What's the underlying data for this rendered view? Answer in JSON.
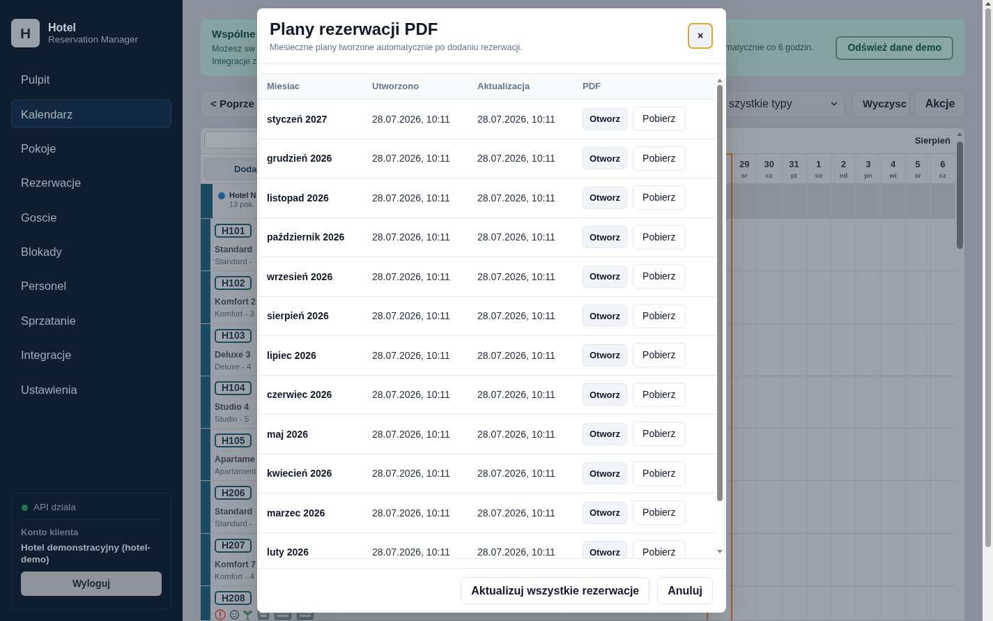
{
  "sidebar": {
    "logo": "H",
    "title": "Hotel",
    "subtitle": "Reservation Manager",
    "items": [
      {
        "label": "Pulpit",
        "selected": false
      },
      {
        "label": "Kalendarz",
        "selected": true
      },
      {
        "label": "Pokoje",
        "selected": false
      },
      {
        "label": "Rezerwacje",
        "selected": false
      },
      {
        "label": "Goscie",
        "selected": false
      },
      {
        "label": "Blokady",
        "selected": false
      },
      {
        "label": "Personel",
        "selected": false
      },
      {
        "label": "Sprzatanie",
        "selected": false
      },
      {
        "label": "Integracje",
        "selected": false
      },
      {
        "label": "Ustawienia",
        "selected": false
      }
    ],
    "status": {
      "label": "API dziala",
      "ok": true
    },
    "account": {
      "heading": "Konto klienta",
      "name": "Hotel demonstracyjny (hotel-demo)",
      "button": "Wyloguj"
    }
  },
  "banner": {
    "title": "Wspólne",
    "lines": [
      "Możesz sw",
      "Integracje z"
    ],
    "note": "matycznie co 6 godzin.",
    "button": "Odśwież dane demo"
  },
  "toolbar": {
    "prev_button": "< Poprze",
    "type_select": "szystkie typy",
    "clear_button": "Wyczysc",
    "actions_button": "Akcje"
  },
  "calendar": {
    "add_button": "Doda",
    "month": "Sierpień",
    "today_marker": true,
    "group": {
      "name": "Hotel N",
      "count": "13 pok."
    },
    "days": [
      {
        "day": "29",
        "weekday": "sr"
      },
      {
        "day": "30",
        "weekday": "cz"
      },
      {
        "day": "31",
        "weekday": "pt"
      },
      {
        "day": "1",
        "weekday": "so"
      },
      {
        "day": "2",
        "weekday": "nd"
      },
      {
        "day": "3",
        "weekday": "pn"
      },
      {
        "day": "4",
        "weekday": "wt"
      },
      {
        "day": "5",
        "weekday": "sr"
      },
      {
        "day": "6",
        "weekday": "cz"
      }
    ],
    "rooms": [
      {
        "kind": "text",
        "code": "H101",
        "name": "Standard",
        "detail": "Standard -"
      },
      {
        "kind": "text",
        "code": "H102",
        "name": "Komfort 2",
        "detail": "Komfort - 3"
      },
      {
        "kind": "text",
        "code": "H103",
        "name": "Deluxe 3",
        "detail": "Deluxe - 4"
      },
      {
        "kind": "text",
        "code": "H104",
        "name": "Studio 4",
        "detail": "Studio - 5"
      },
      {
        "kind": "text",
        "code": "H105",
        "name": "Apartame",
        "detail": "Apartament"
      },
      {
        "kind": "text",
        "code": "H206",
        "name": "Standard",
        "detail": "Standard -"
      },
      {
        "kind": "text",
        "code": "H207",
        "name": "Komfort 7",
        "detail": "Komfort - 4"
      },
      {
        "kind": "icons",
        "code": "H208"
      }
    ]
  },
  "modal": {
    "title": "Plany rezerwacji PDF",
    "subtitle": "Miesieczne plany tworzone automatycznie po dodaniu rezerwacji.",
    "close": {
      "label": "×",
      "focused": true
    },
    "columns": [
      "Miesiac",
      "Utworzono",
      "Aktualizacja",
      "PDF"
    ],
    "rows": [
      {
        "month": "styczeń 2027",
        "created": "28.07.2026, 10:11",
        "updated": "28.07.2026, 10:11",
        "open": "Otworz",
        "download": "Pobierz"
      },
      {
        "month": "grudzień 2026",
        "created": "28.07.2026, 10:11",
        "updated": "28.07.2026, 10:11",
        "open": "Otworz",
        "download": "Pobierz"
      },
      {
        "month": "listopad 2026",
        "created": "28.07.2026, 10:11",
        "updated": "28.07.2026, 10:11",
        "open": "Otworz",
        "download": "Pobierz"
      },
      {
        "month": "październik 2026",
        "created": "28.07.2026, 10:11",
        "updated": "28.07.2026, 10:11",
        "open": "Otworz",
        "download": "Pobierz"
      },
      {
        "month": "wrzesień 2026",
        "created": "28.07.2026, 10:11",
        "updated": "28.07.2026, 10:11",
        "open": "Otworz",
        "download": "Pobierz"
      },
      {
        "month": "sierpień 2026",
        "created": "28.07.2026, 10:11",
        "updated": "28.07.2026, 10:11",
        "open": "Otworz",
        "download": "Pobierz"
      },
      {
        "month": "lipiec 2026",
        "created": "28.07.2026, 10:11",
        "updated": "28.07.2026, 10:11",
        "open": "Otworz",
        "download": "Pobierz"
      },
      {
        "month": "czerwiec 2026",
        "created": "28.07.2026, 10:11",
        "updated": "28.07.2026, 10:11",
        "open": "Otworz",
        "download": "Pobierz"
      },
      {
        "month": "maj 2026",
        "created": "28.07.2026, 10:11",
        "updated": "28.07.2026, 10:11",
        "open": "Otworz",
        "download": "Pobierz"
      },
      {
        "month": "kwiecień 2026",
        "created": "28.07.2026, 10:11",
        "updated": "28.07.2026, 10:11",
        "open": "Otworz",
        "download": "Pobierz"
      },
      {
        "month": "marzec 2026",
        "created": "28.07.2026, 10:11",
        "updated": "28.07.2026, 10:11",
        "open": "Otworz",
        "download": "Pobierz"
      },
      {
        "month": "luty 2026",
        "created": "28.07.2026, 10:11",
        "updated": "28.07.2026, 10:11",
        "open": "Otworz",
        "download": "Pobierz"
      }
    ],
    "footer_buttons": [
      "Aktualizuj wszystkie rezerwacje",
      "Anuluj"
    ]
  }
}
